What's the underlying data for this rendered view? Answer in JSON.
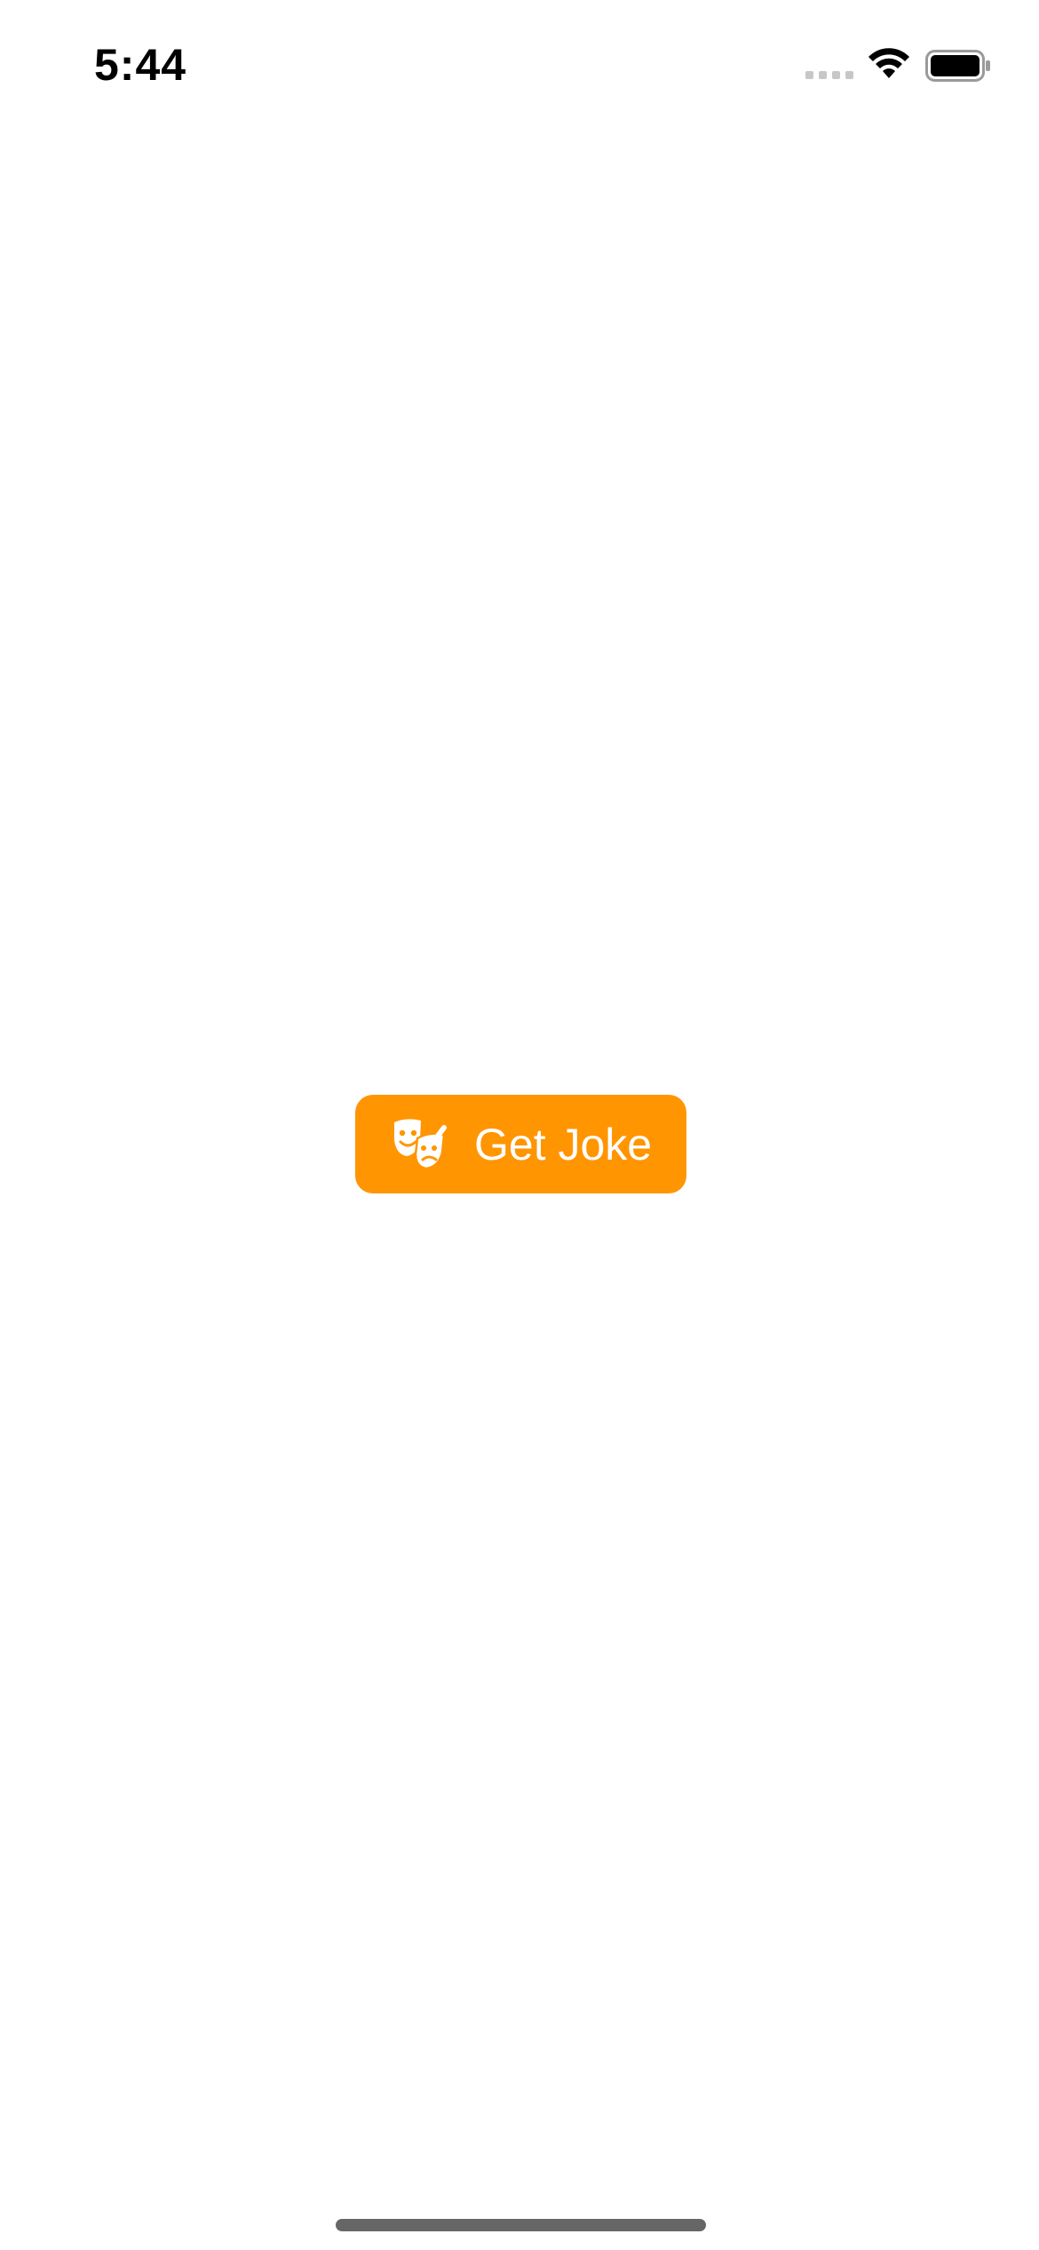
{
  "status_bar": {
    "time": "5:44",
    "icons": [
      "signal-dots-icon",
      "wifi-icon",
      "battery-icon"
    ]
  },
  "main": {
    "button": {
      "label": "Get Joke",
      "icon": "theater-masks-icon",
      "color": "#FF9500",
      "text_color": "#FFFFFF"
    }
  },
  "home_indicator": {}
}
